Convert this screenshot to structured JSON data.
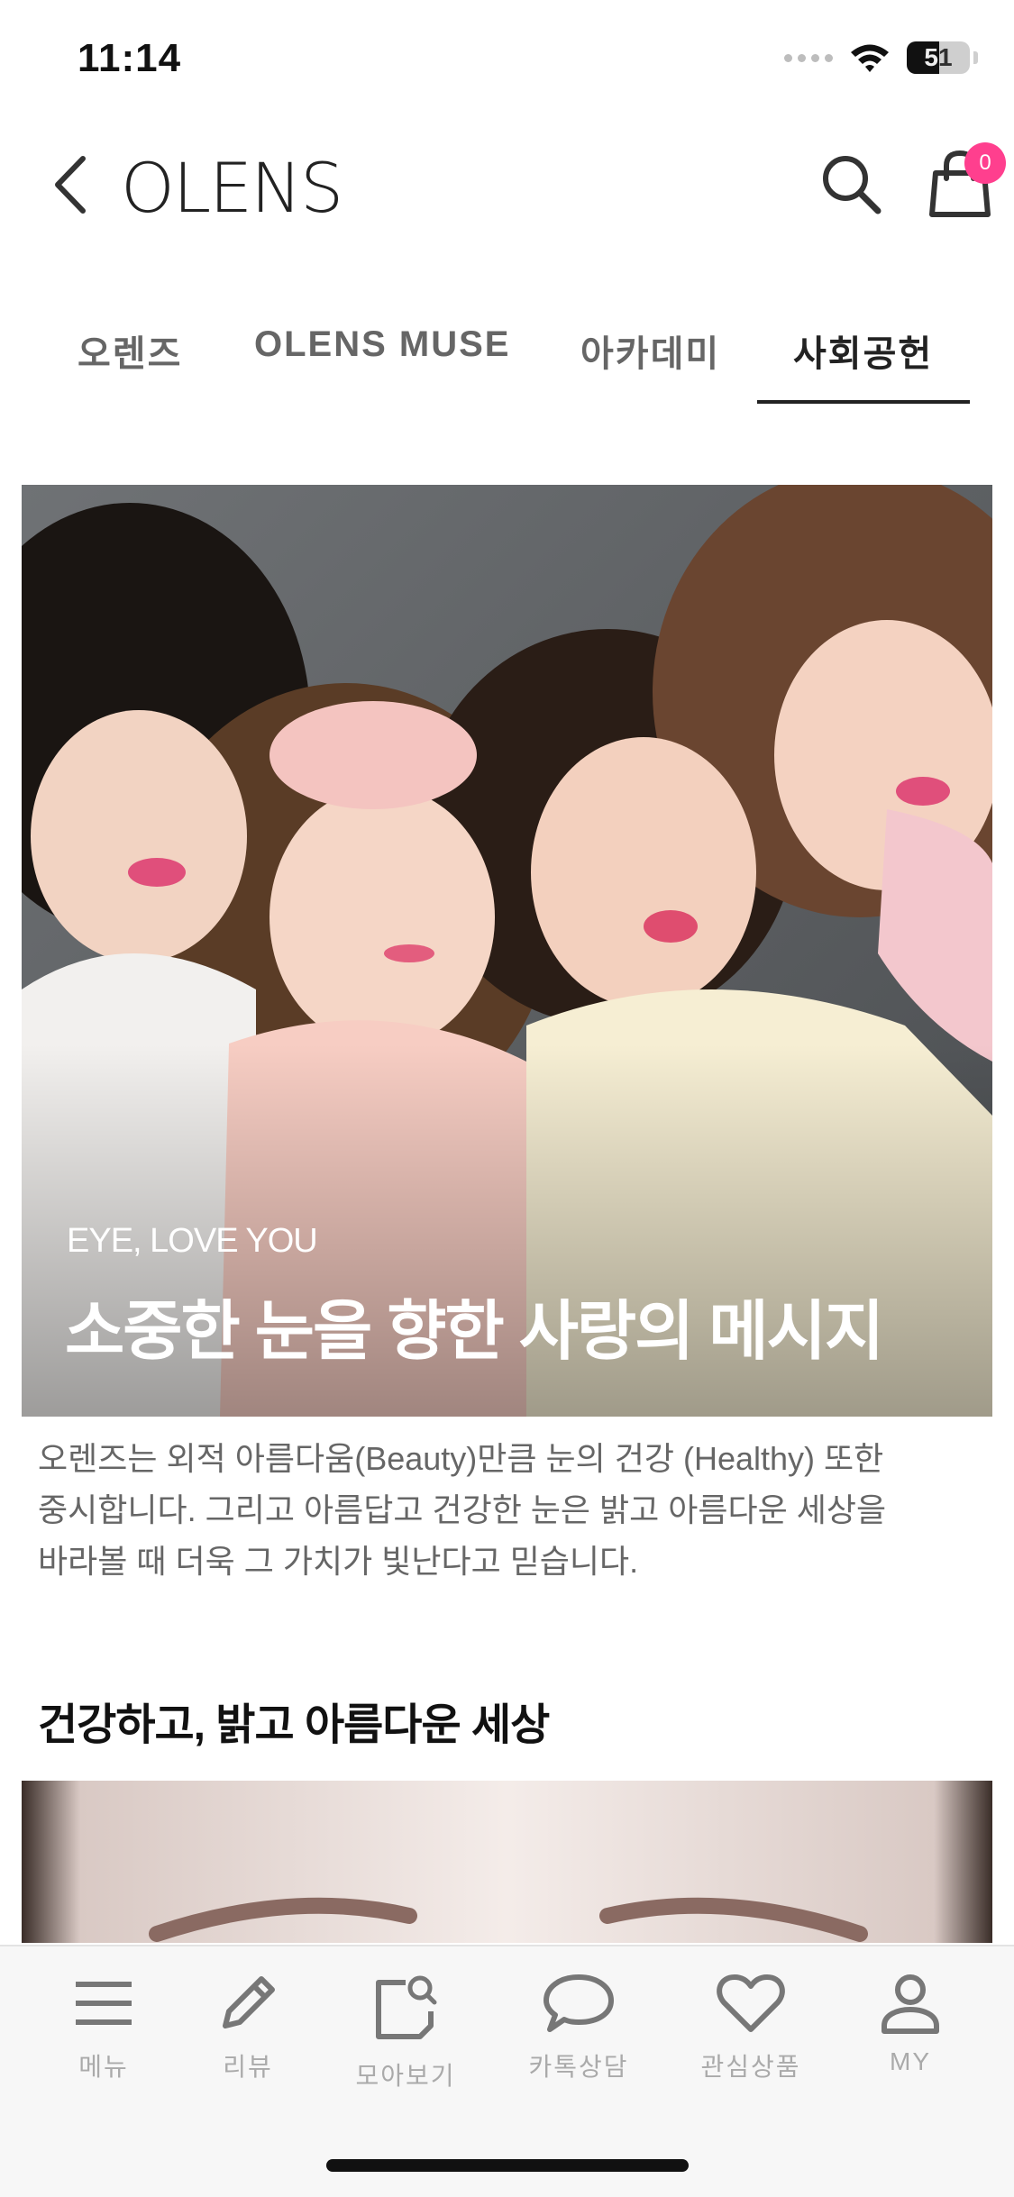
{
  "status_bar": {
    "time": "11:14",
    "battery": "51",
    "battery_level": 0.51
  },
  "header": {
    "logo": "OLENS",
    "cart_count": "0"
  },
  "tabs": [
    {
      "label": "오렌즈",
      "active": false
    },
    {
      "label": "OLENS MUSE",
      "active": false
    },
    {
      "label": "아카데미",
      "active": false
    },
    {
      "label": "사회공헌",
      "active": true
    }
  ],
  "hero": {
    "subtitle": "EYE, LOVE YOU",
    "title": "소중한 눈을 향한 사랑의 메시지"
  },
  "description": {
    "line1": "오렌즈는 외적 아름다움(Beauty)만큼 눈의 건강 (Healthy) 또한",
    "line2": "중시합니다. 그리고 아름답고 건강한 눈은 밝고 아름다운 세상을",
    "line3": "바라볼 때 더욱 그 가치가 빛난다고 믿습니다."
  },
  "section": {
    "title": "건강하고, 밝고 아름다운 세상"
  },
  "bottom_nav": [
    {
      "label": "메뉴",
      "icon": "menu-icon"
    },
    {
      "label": "리뷰",
      "icon": "pencil-icon"
    },
    {
      "label": "모아보기",
      "icon": "collection-icon"
    },
    {
      "label": "카톡상담",
      "icon": "chat-icon"
    },
    {
      "label": "관심상품",
      "icon": "heart-icon"
    },
    {
      "label": "MY",
      "icon": "person-icon"
    }
  ],
  "colors": {
    "badge": "#ff3f8e",
    "tab_active": "#222222",
    "nav_icon": "#777777"
  }
}
